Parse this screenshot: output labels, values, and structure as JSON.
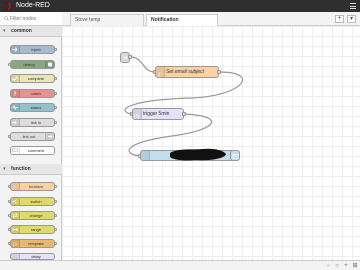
{
  "app": {
    "title": "Node-RED"
  },
  "palette": {
    "filter_placeholder": "Filter nodes",
    "categories": [
      {
        "label": "common"
      },
      {
        "label": "function"
      }
    ],
    "common_nodes": [
      {
        "label": "inject",
        "color": "#a6bbcf",
        "icon": "arrow-right-icon"
      },
      {
        "label": "debug",
        "color": "#87a980",
        "icon": "bug-icon"
      },
      {
        "label": "complete",
        "color": "#e7e7ae",
        "icon": "check-icon"
      },
      {
        "label": "catch",
        "color": "#e49191",
        "icon": "exclamation-icon"
      },
      {
        "label": "status",
        "color": "#94c1d0",
        "icon": "pulse-icon"
      },
      {
        "label": "link in",
        "color": "#dddddd",
        "icon": "arrow-in-icon"
      },
      {
        "label": "link out",
        "color": "#dddddd",
        "icon": "arrow-out-icon"
      },
      {
        "label": "comment",
        "color": "#ffffff",
        "icon": "comment-icon"
      }
    ],
    "function_nodes": [
      {
        "label": "function",
        "color": "#fdd0a2",
        "icon": "function-icon"
      },
      {
        "label": "switch",
        "color": "#e2d96e",
        "icon": "switch-icon"
      },
      {
        "label": "change",
        "color": "#e2d96e",
        "icon": "change-icon"
      },
      {
        "label": "range",
        "color": "#e2d96e",
        "icon": "range-icon"
      },
      {
        "label": "template",
        "color": "#e7b86e",
        "icon": "template-icon"
      },
      {
        "label": "delay",
        "color": "#e6e0f8",
        "icon": "timer-icon"
      }
    ]
  },
  "workspace": {
    "tabs": [
      {
        "label": "Stove temp"
      },
      {
        "label": "Notification"
      }
    ],
    "add_tab": "+",
    "list_flows": "▾"
  },
  "flow": {
    "nodes": [
      {
        "label": "",
        "color": "#d9d9d9",
        "icon": "link-in-icon"
      },
      {
        "label": "Set email subject",
        "color": "#fdd0a2",
        "icon": "function-icon"
      },
      {
        "label": "trigger 5min",
        "color": "#e6e0f8",
        "icon": "timer-icon"
      },
      {
        "label": "",
        "color": "#c0deed",
        "icon": "email-icon",
        "redacted": true
      }
    ]
  },
  "footer": {
    "zoom_out": "−",
    "zoom_reset": "○",
    "zoom_in": "+",
    "navigator": "⊞"
  },
  "colors": {
    "header_bg": "#2f2f2f",
    "wire": "#999999",
    "redaction": "#111111"
  }
}
